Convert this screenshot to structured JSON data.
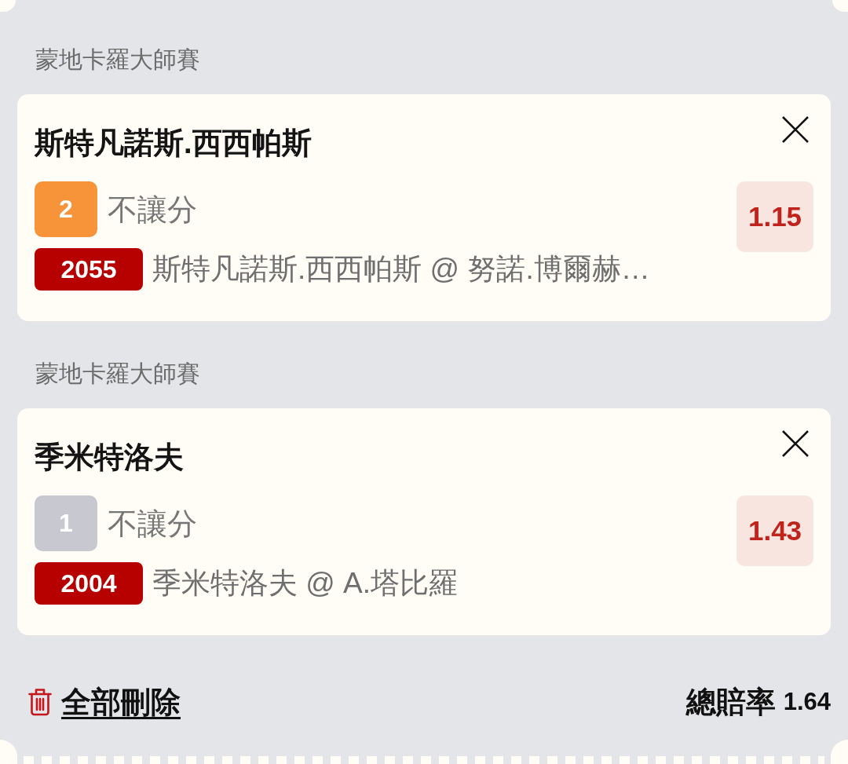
{
  "legs": [
    {
      "league": "蒙地卡羅大師賽",
      "title": "斯特凡諾斯.西西帕斯",
      "pick": {
        "label": "2",
        "color": "#f7943a"
      },
      "market": "不讓分",
      "match_code": "2055",
      "match": "斯特凡諾斯.西西帕斯 @ 努諾.博爾赫…",
      "odds": "1.15"
    },
    {
      "league": "蒙地卡羅大師賽",
      "title": "季米特洛夫",
      "pick": {
        "label": "1",
        "color": "#c8c9d0"
      },
      "market": "不讓分",
      "match_code": "2004",
      "match": "季米特洛夫 @ A.塔比羅",
      "odds": "1.43"
    }
  ],
  "footer": {
    "delete_all": "全部刪除",
    "total_odds_label": "總賠率",
    "total_odds": "1.64"
  }
}
